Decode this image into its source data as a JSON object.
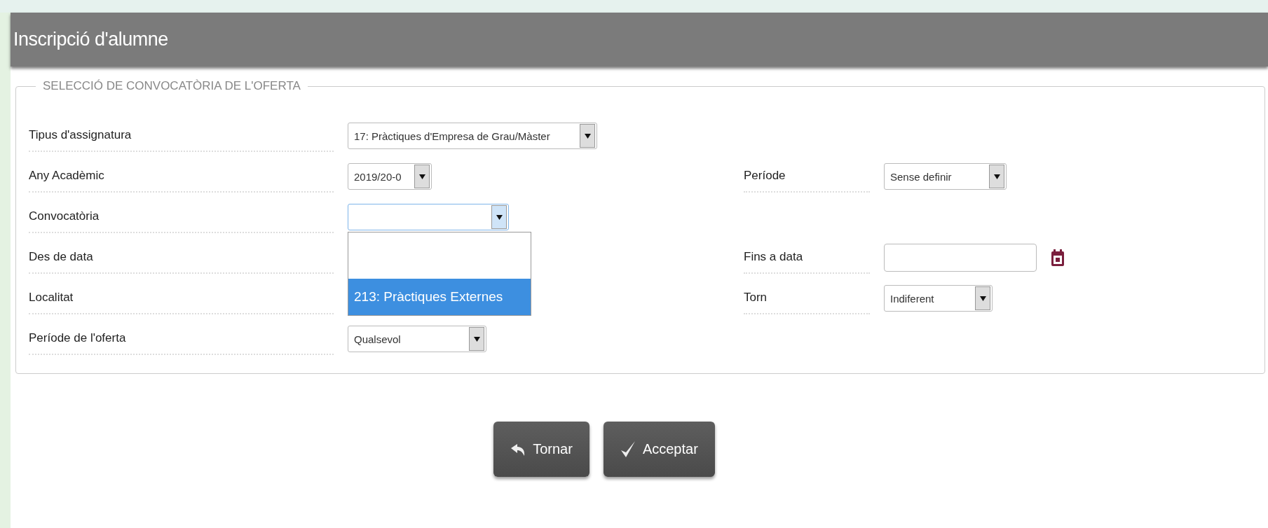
{
  "page_title": "Inscripció d'alumne",
  "section": {
    "legend": "SELECCIÓ DE CONVOCATÒRIA DE L'OFERTA",
    "rows": [
      {
        "label": "Tipus d'assignatura",
        "control": {
          "kind": "select",
          "value": "17: Pràctiques d'Empresa de Grau/Màster"
        }
      },
      {
        "label": "Any Acadèmic",
        "control": {
          "kind": "select",
          "value": "2019/20-0"
        },
        "right": {
          "label": "Període",
          "control": {
            "kind": "select",
            "value": "Sense definir"
          }
        }
      },
      {
        "label": "Convocatòria",
        "control": {
          "kind": "select",
          "open": true,
          "options": [
            {
              "kind": "text",
              "label": "213: Pràctiques Externes",
              "selected": true
            }
          ]
        }
      },
      {
        "label": "Des de data",
        "right": {
          "label": "Fins a data",
          "control": {
            "kind": "date"
          }
        }
      },
      {
        "label": "Localitat",
        "right": {
          "label": "Torn",
          "control": {
            "kind": "select",
            "value": "Indiferent"
          }
        }
      },
      {
        "label": "Període de l'oferta",
        "control": {
          "kind": "select",
          "value": "Qualsevol"
        }
      }
    ]
  },
  "buttons": [
    {
      "kind": "back",
      "label": "Tornar"
    },
    {
      "kind": "accept",
      "label": "Acceptar"
    }
  ]
}
